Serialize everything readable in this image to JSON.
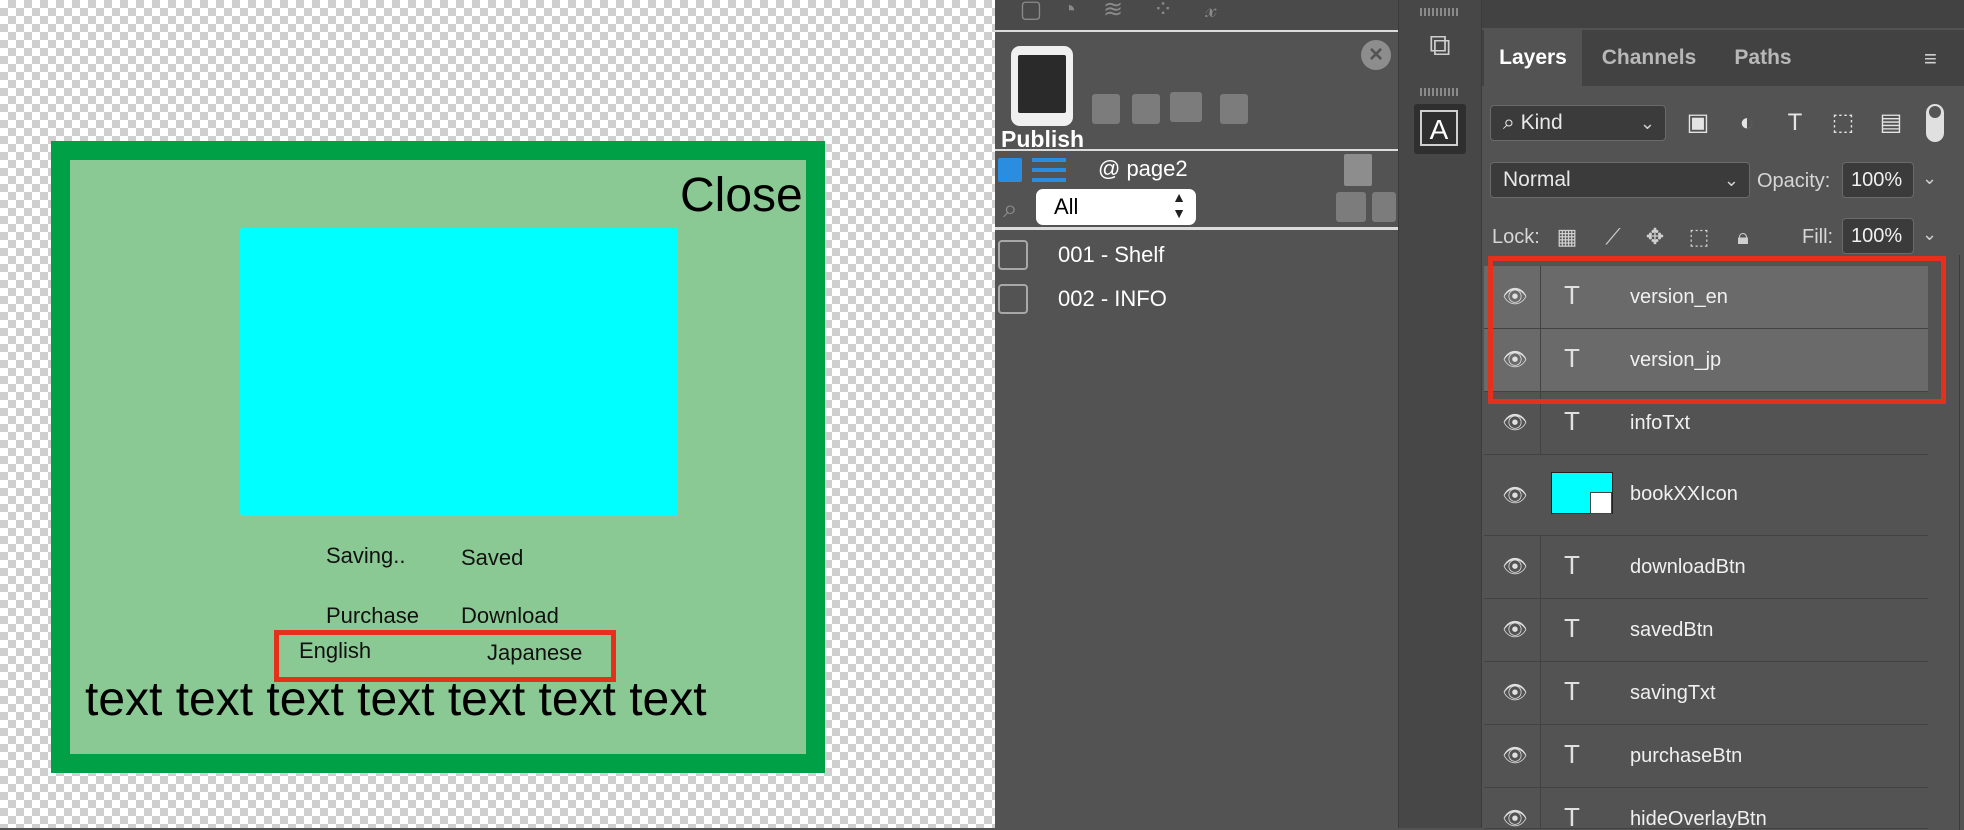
{
  "canvas": {
    "close_label": "Close",
    "saving_label": "Saving..",
    "saved_label": "Saved",
    "purchase_label": "Purchase",
    "download_label": "Download",
    "english_label": "English",
    "japanese_label": "Japanese",
    "info_text": "text text text text text text text",
    "colors": {
      "artboard_fill": "#8bc994",
      "artboard_border": "#00a046",
      "book_icon": "#00ffff",
      "highlight": "#e5301c"
    }
  },
  "publish_panel": {
    "publish_label": "Publish",
    "page_label": "@ page2",
    "filter_value": "All",
    "pages": [
      "001 - Shelf",
      "002 - INFO"
    ]
  },
  "layers_panel": {
    "tabs": [
      "Layers",
      "Channels",
      "Paths"
    ],
    "active_tab": "Layers",
    "kind_filter": "Kind",
    "blend_mode": "Normal",
    "opacity_label": "Opacity:",
    "opacity_value": "100%",
    "lock_label": "Lock:",
    "fill_label": "Fill:",
    "fill_value": "100%",
    "layers": [
      {
        "name": "version_en",
        "type": "text",
        "selected": true
      },
      {
        "name": "version_jp",
        "type": "text",
        "selected": true
      },
      {
        "name": "infoTxt",
        "type": "text",
        "selected": false
      },
      {
        "name": "bookXXIcon",
        "type": "smart-object",
        "selected": false
      },
      {
        "name": "downloadBtn",
        "type": "text",
        "selected": false
      },
      {
        "name": "savedBtn",
        "type": "text",
        "selected": false
      },
      {
        "name": "savingTxt",
        "type": "text",
        "selected": false
      },
      {
        "name": "purchaseBtn",
        "type": "text",
        "selected": false
      },
      {
        "name": "hideOverlayBtn",
        "type": "text",
        "selected": false
      }
    ],
    "type_glyph": "T"
  }
}
